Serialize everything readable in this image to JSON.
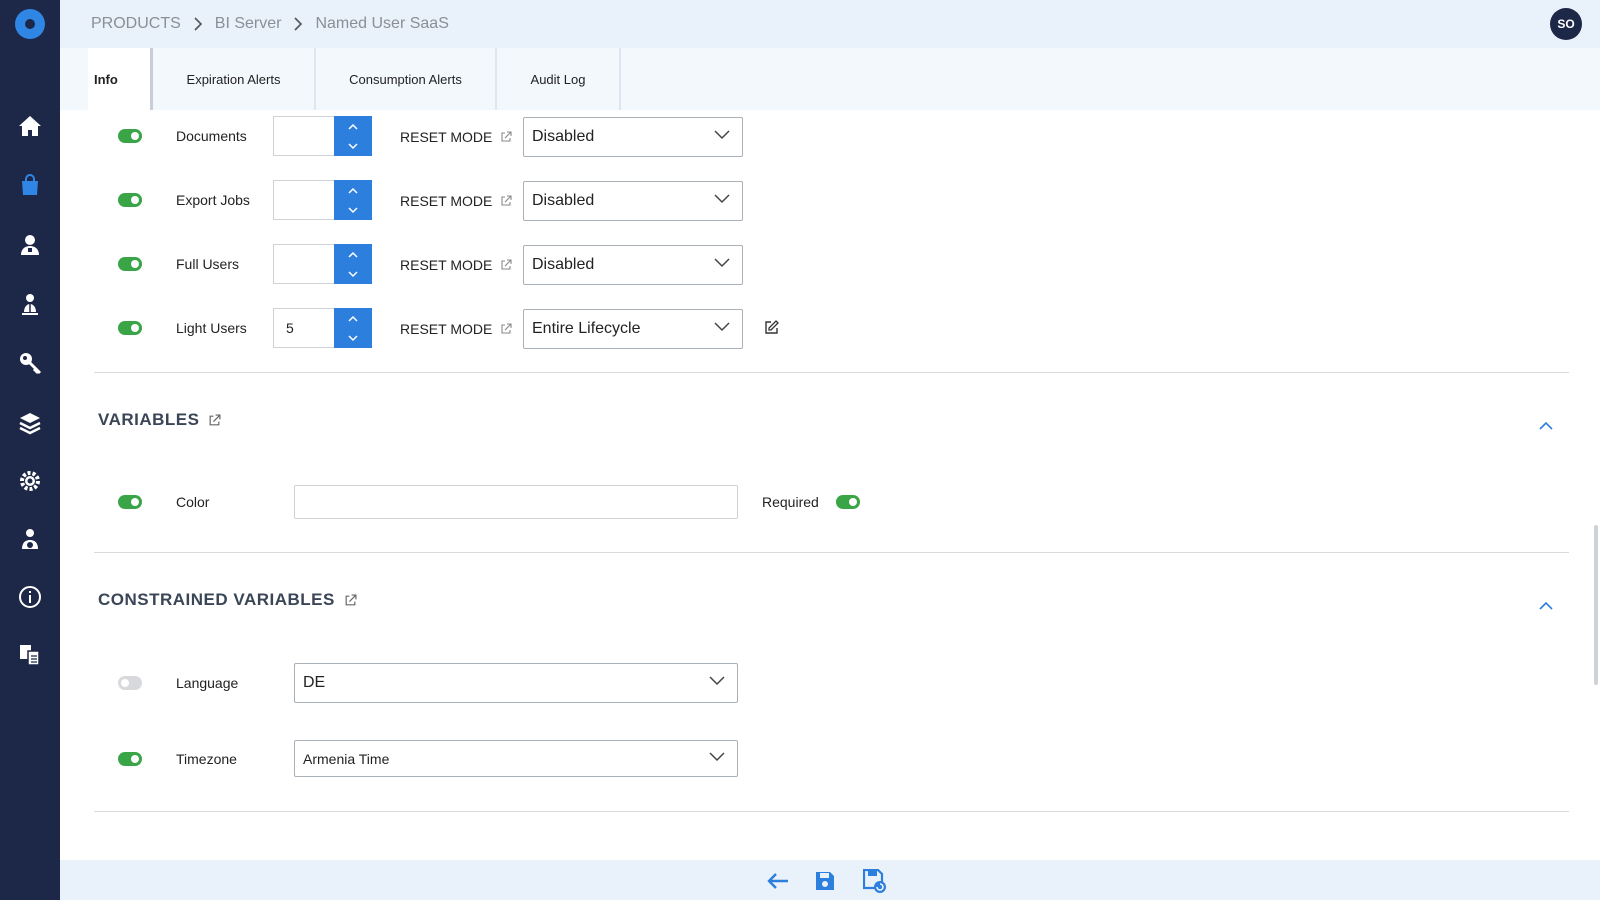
{
  "sidebar": {
    "items": [
      {
        "icon": "home-icon"
      },
      {
        "icon": "shopping-bag-icon",
        "active": true
      },
      {
        "icon": "user-badge-icon"
      },
      {
        "icon": "user-group-icon"
      },
      {
        "icon": "key-icon"
      },
      {
        "icon": "layers-icon"
      },
      {
        "icon": "gear-icon"
      },
      {
        "icon": "user-settings-icon"
      },
      {
        "icon": "info-icon"
      },
      {
        "icon": "documents-icon"
      }
    ]
  },
  "header": {
    "breadcrumb": [
      "PRODUCTS",
      "BI Server",
      "Named User SaaS"
    ],
    "avatar": "SO"
  },
  "tabs": [
    {
      "label": "Info",
      "active": true
    },
    {
      "label": "Expiration Alerts"
    },
    {
      "label": "Consumption Alerts"
    },
    {
      "label": "Audit Log"
    }
  ],
  "features": [
    {
      "name": "Documents",
      "enabled": true,
      "value": "",
      "reset_label": "RESET MODE",
      "mode": "Disabled"
    },
    {
      "name": "Export Jobs",
      "enabled": true,
      "value": "",
      "reset_label": "RESET MODE",
      "mode": "Disabled"
    },
    {
      "name": "Full Users",
      "enabled": true,
      "value": "",
      "reset_label": "RESET MODE",
      "mode": "Disabled"
    },
    {
      "name": "Light Users",
      "enabled": true,
      "value": "5",
      "reset_label": "RESET MODE",
      "mode": "Entire Lifecycle",
      "editable": true
    }
  ],
  "variables": {
    "title": "VARIABLES",
    "items": [
      {
        "name": "Color",
        "enabled": true,
        "value": "",
        "required_label": "Required",
        "required": true
      }
    ]
  },
  "constrained_variables": {
    "title": "CONSTRAINED VARIABLES",
    "items": [
      {
        "name": "Language",
        "enabled": false,
        "value": "DE"
      },
      {
        "name": "Timezone",
        "enabled": true,
        "value": "Armenia Time"
      }
    ]
  },
  "colors": {
    "sidebar_bg": "#1d2747",
    "accent": "#2c7fdc",
    "toggle_on": "#3aa547",
    "header_bg": "#e9f1fa"
  }
}
